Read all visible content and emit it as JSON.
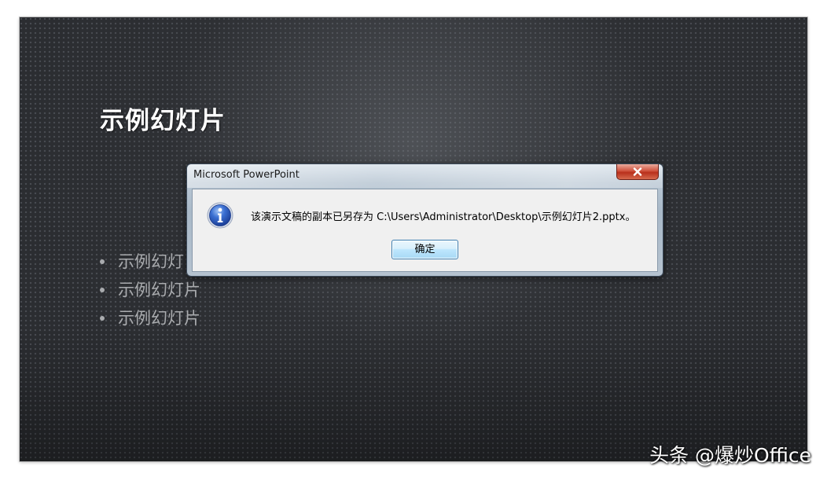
{
  "slide": {
    "title": "示例幻灯片",
    "bullets": [
      "示例幻灯",
      "示例幻灯片",
      "示例幻灯片"
    ]
  },
  "dialog": {
    "title": "Microsoft PowerPoint",
    "message": "该演示文稿的副本已另存为 C:\\Users\\Administrator\\Desktop\\示例幻灯片2.pptx。",
    "ok_label": "确定",
    "icon": "info-icon",
    "close_icon": "close-icon"
  },
  "watermark": {
    "text": "头条 @爆炒Office"
  },
  "colors": {
    "slide_background": "#2b2d31",
    "title_text": "#ffffff",
    "bullet_text": "#a9abae",
    "close_button": "#c8412a",
    "info_icon": "#2a56b8"
  }
}
